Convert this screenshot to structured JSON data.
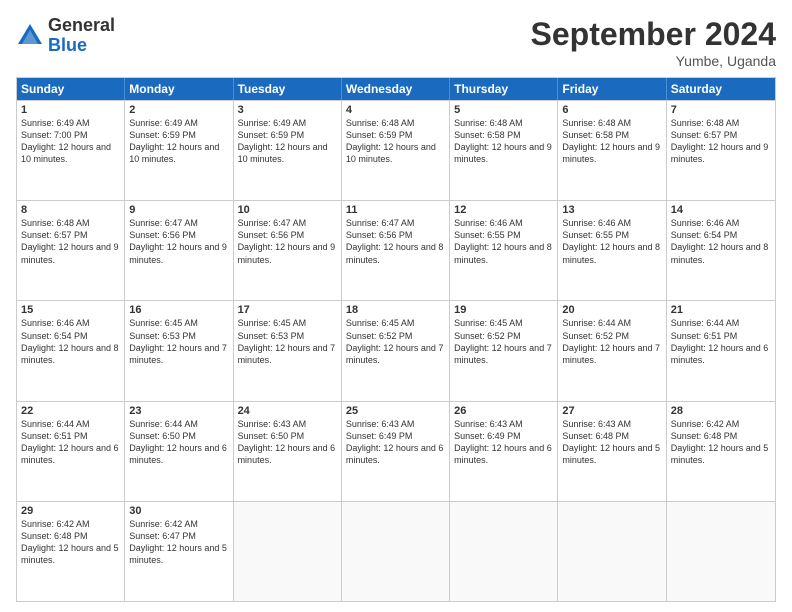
{
  "logo": {
    "general": "General",
    "blue": "Blue"
  },
  "title": "September 2024",
  "location": "Yumbe, Uganda",
  "days": [
    "Sunday",
    "Monday",
    "Tuesday",
    "Wednesday",
    "Thursday",
    "Friday",
    "Saturday"
  ],
  "weeks": [
    [
      {
        "day": "1",
        "text": "Sunrise: 6:49 AM\nSunset: 7:00 PM\nDaylight: 12 hours and 10 minutes."
      },
      {
        "day": "2",
        "text": "Sunrise: 6:49 AM\nSunset: 6:59 PM\nDaylight: 12 hours and 10 minutes."
      },
      {
        "day": "3",
        "text": "Sunrise: 6:49 AM\nSunset: 6:59 PM\nDaylight: 12 hours and 10 minutes."
      },
      {
        "day": "4",
        "text": "Sunrise: 6:48 AM\nSunset: 6:59 PM\nDaylight: 12 hours and 10 minutes."
      },
      {
        "day": "5",
        "text": "Sunrise: 6:48 AM\nSunset: 6:58 PM\nDaylight: 12 hours and 9 minutes."
      },
      {
        "day": "6",
        "text": "Sunrise: 6:48 AM\nSunset: 6:58 PM\nDaylight: 12 hours and 9 minutes."
      },
      {
        "day": "7",
        "text": "Sunrise: 6:48 AM\nSunset: 6:57 PM\nDaylight: 12 hours and 9 minutes."
      }
    ],
    [
      {
        "day": "8",
        "text": "Sunrise: 6:48 AM\nSunset: 6:57 PM\nDaylight: 12 hours and 9 minutes."
      },
      {
        "day": "9",
        "text": "Sunrise: 6:47 AM\nSunset: 6:56 PM\nDaylight: 12 hours and 9 minutes."
      },
      {
        "day": "10",
        "text": "Sunrise: 6:47 AM\nSunset: 6:56 PM\nDaylight: 12 hours and 9 minutes."
      },
      {
        "day": "11",
        "text": "Sunrise: 6:47 AM\nSunset: 6:56 PM\nDaylight: 12 hours and 8 minutes."
      },
      {
        "day": "12",
        "text": "Sunrise: 6:46 AM\nSunset: 6:55 PM\nDaylight: 12 hours and 8 minutes."
      },
      {
        "day": "13",
        "text": "Sunrise: 6:46 AM\nSunset: 6:55 PM\nDaylight: 12 hours and 8 minutes."
      },
      {
        "day": "14",
        "text": "Sunrise: 6:46 AM\nSunset: 6:54 PM\nDaylight: 12 hours and 8 minutes."
      }
    ],
    [
      {
        "day": "15",
        "text": "Sunrise: 6:46 AM\nSunset: 6:54 PM\nDaylight: 12 hours and 8 minutes."
      },
      {
        "day": "16",
        "text": "Sunrise: 6:45 AM\nSunset: 6:53 PM\nDaylight: 12 hours and 7 minutes."
      },
      {
        "day": "17",
        "text": "Sunrise: 6:45 AM\nSunset: 6:53 PM\nDaylight: 12 hours and 7 minutes."
      },
      {
        "day": "18",
        "text": "Sunrise: 6:45 AM\nSunset: 6:52 PM\nDaylight: 12 hours and 7 minutes."
      },
      {
        "day": "19",
        "text": "Sunrise: 6:45 AM\nSunset: 6:52 PM\nDaylight: 12 hours and 7 minutes."
      },
      {
        "day": "20",
        "text": "Sunrise: 6:44 AM\nSunset: 6:52 PM\nDaylight: 12 hours and 7 minutes."
      },
      {
        "day": "21",
        "text": "Sunrise: 6:44 AM\nSunset: 6:51 PM\nDaylight: 12 hours and 6 minutes."
      }
    ],
    [
      {
        "day": "22",
        "text": "Sunrise: 6:44 AM\nSunset: 6:51 PM\nDaylight: 12 hours and 6 minutes."
      },
      {
        "day": "23",
        "text": "Sunrise: 6:44 AM\nSunset: 6:50 PM\nDaylight: 12 hours and 6 minutes."
      },
      {
        "day": "24",
        "text": "Sunrise: 6:43 AM\nSunset: 6:50 PM\nDaylight: 12 hours and 6 minutes."
      },
      {
        "day": "25",
        "text": "Sunrise: 6:43 AM\nSunset: 6:49 PM\nDaylight: 12 hours and 6 minutes."
      },
      {
        "day": "26",
        "text": "Sunrise: 6:43 AM\nSunset: 6:49 PM\nDaylight: 12 hours and 6 minutes."
      },
      {
        "day": "27",
        "text": "Sunrise: 6:43 AM\nSunset: 6:48 PM\nDaylight: 12 hours and 5 minutes."
      },
      {
        "day": "28",
        "text": "Sunrise: 6:42 AM\nSunset: 6:48 PM\nDaylight: 12 hours and 5 minutes."
      }
    ],
    [
      {
        "day": "29",
        "text": "Sunrise: 6:42 AM\nSunset: 6:48 PM\nDaylight: 12 hours and 5 minutes."
      },
      {
        "day": "30",
        "text": "Sunrise: 6:42 AM\nSunset: 6:47 PM\nDaylight: 12 hours and 5 minutes."
      },
      {
        "day": "",
        "text": ""
      },
      {
        "day": "",
        "text": ""
      },
      {
        "day": "",
        "text": ""
      },
      {
        "day": "",
        "text": ""
      },
      {
        "day": "",
        "text": ""
      }
    ]
  ]
}
